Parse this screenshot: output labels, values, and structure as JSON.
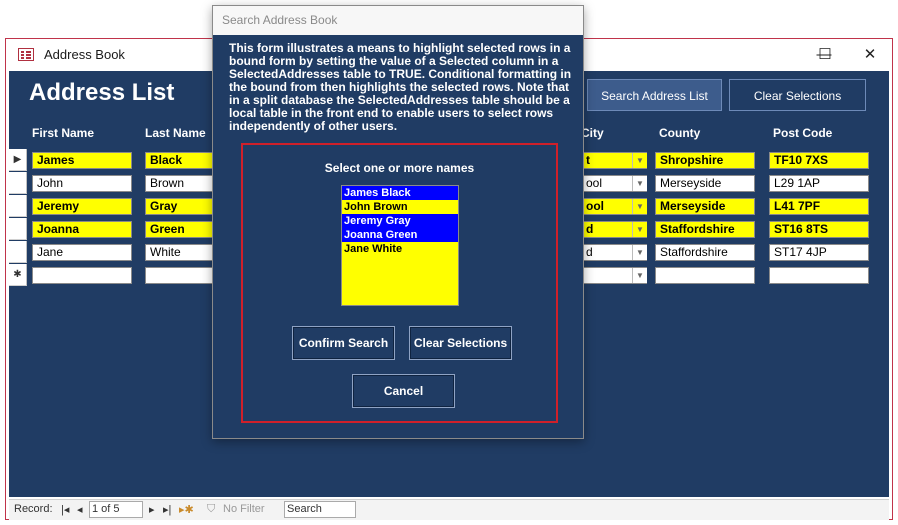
{
  "window": {
    "title": "Address Book",
    "controls": [
      "—",
      "☐",
      "✕"
    ]
  },
  "form": {
    "title": "Address List",
    "search_button": "Search Address List",
    "clear_button": "Clear Selections",
    "headers": [
      "First Name",
      "Last Name",
      "City",
      "County",
      "Post Code"
    ],
    "rows": [
      {
        "first": "James",
        "last": "Black",
        "city": "t",
        "county": "Shropshire",
        "post": "TF10 7XS",
        "selected": true
      },
      {
        "first": "John",
        "last": "Brown",
        "city": "ool",
        "county": "Merseyside",
        "post": "L29 1AP",
        "selected": false
      },
      {
        "first": "Jeremy",
        "last": "Gray",
        "city": "ool",
        "county": "Merseyside",
        "post": "L41 7PF",
        "selected": true
      },
      {
        "first": "Joanna",
        "last": "Green",
        "city": "d",
        "county": "Staffordshire",
        "post": "ST16 8TS",
        "selected": true
      },
      {
        "first": "Jane",
        "last": "White",
        "city": "d",
        "county": "Staffordshire",
        "post": "ST17 4JP",
        "selected": false
      }
    ],
    "new_row_marker": "✱"
  },
  "navbar": {
    "record_label": "Record:",
    "position": "1 of 5",
    "filter": "No Filter",
    "search": "Search"
  },
  "dialog": {
    "title": "Search Address Book",
    "description": "This form illustrates a means to highlight selected rows in a bound form by setting the value of a Selected column in a SelectedAddresses table to TRUE.  Conditional formatting in the bound from then highlights the selected rows.  Note that in a split database the SelectedAddresses table should be a local table in the front end to enable users to select rows independently of other users.",
    "prompt": "Select one or more names",
    "options": [
      {
        "label": "James Black",
        "selected": true
      },
      {
        "label": "John Brown",
        "selected": false
      },
      {
        "label": "Jeremy Gray",
        "selected": true
      },
      {
        "label": "Joanna Green",
        "selected": true
      },
      {
        "label": "Jane White",
        "selected": false
      }
    ],
    "confirm_button": "Confirm Search",
    "clear_button": "Clear Selections",
    "cancel_button": "Cancel"
  },
  "colors": {
    "form_bg": "#203c64",
    "highlight": "#ffff00",
    "list_selected": "#0000ff",
    "frame": "#d0202a"
  }
}
